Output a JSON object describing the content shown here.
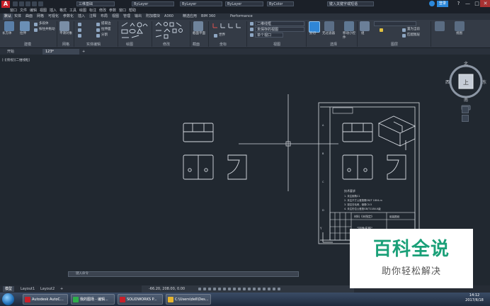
{
  "app": {
    "logo": "A",
    "title_text": "Autodesk AutoCAD 2016",
    "workspace": "三维基础",
    "layer_value": "ByLayer",
    "linetype_value": "ByLayer",
    "lineweight_value": "ByLayer",
    "plotstyle_value": "ByColor",
    "search_placeholder": "键入关键字或短语",
    "signin_label": "登录",
    "help": "?",
    "minimize": "—",
    "maximize": "□",
    "close": "✕"
  },
  "menubar": [
    "窗口",
    "文件",
    "编辑",
    "视图",
    "插入",
    "格式",
    "工具",
    "绘图",
    "标注",
    "修改",
    "参数",
    "窗口",
    "帮助"
  ],
  "ribbon_tabs": [
    "默认",
    "实体",
    "曲面",
    "网格",
    "可视化",
    "参数化",
    "插入",
    "注释",
    "布局",
    "视图",
    "管理",
    "输出",
    "附加模块",
    "A360",
    "精选应用",
    "BIM 360",
    "Performance"
  ],
  "ribbon": {
    "groups": [
      {
        "title": "建模",
        "items": [
          "长方体",
          "拉伸",
          "多段体",
          "按住并拖动"
        ]
      },
      {
        "title": "网格",
        "items": [
          "平滑对象"
        ]
      },
      {
        "title": "实体编辑",
        "items": [
          "提取边",
          "拉伸面",
          "分割"
        ]
      },
      {
        "title": "绘图",
        "items": []
      },
      {
        "title": "修改",
        "items": []
      },
      {
        "title": "截面",
        "items": [
          "截面平面"
        ]
      },
      {
        "title": "坐标",
        "items": [
          "世界"
        ]
      },
      {
        "title": "视图",
        "items": [
          "二维线框",
          "未保存的视图",
          "单个视口"
        ]
      },
      {
        "title": "选择",
        "items": [
          "剪切"
        ]
      },
      {
        "title": "图层",
        "items": [
          "无过滤器",
          "移动小控件",
          "组",
          "置为当前",
          "匹配图层"
        ]
      },
      {
        "title": "",
        "items": [
          "视图"
        ]
      }
    ]
  },
  "doc_tabs": [
    "开始",
    "123*"
  ],
  "doc_tab_add": "+",
  "viewport_label": "[-][俯视][二维线框]",
  "navcube": {
    "north": "北",
    "south": "南",
    "east": "东",
    "west": "西",
    "top": "上"
  },
  "wcs_label": "WCS",
  "titleblock": {
    "tech_title": "技术要求",
    "tech_lines": [
      "1. 未注倒角C1",
      "2. 未注尺寸公差按照GB/T 1804-m",
      "3. 锐边去毛刺，倒角C0.5",
      "4. 未注形位公差按GB/T1184-K级"
    ],
    "part_name": "材料《未指定》",
    "drawing_name": "\"固件名称\"",
    "company": "组装图纸"
  },
  "command_prompt": "键入命令",
  "layout_tabs": [
    "模型",
    "Layout1",
    "Layout2"
  ],
  "layout_add": "+",
  "status": {
    "coords": "-66.20, 208.00, 0.00",
    "scale": "1:1 / 100%",
    "units": "小数"
  },
  "taskbar": {
    "items": [
      "Autodesk AutoC...",
      "我的图场 - 编辑...",
      "SOLIDWORKS P...",
      "C:\\Users\\dell\\Des..."
    ],
    "clock_time": "14:12",
    "clock_date": "2017/6/18"
  },
  "watermark": {
    "line1": "百科全说",
    "line2": "助你轻松解决"
  },
  "colors": {
    "background": "#212830",
    "ribbon": "#343b46",
    "accent": "#1aa078",
    "autocad_red": "#c8202a"
  }
}
